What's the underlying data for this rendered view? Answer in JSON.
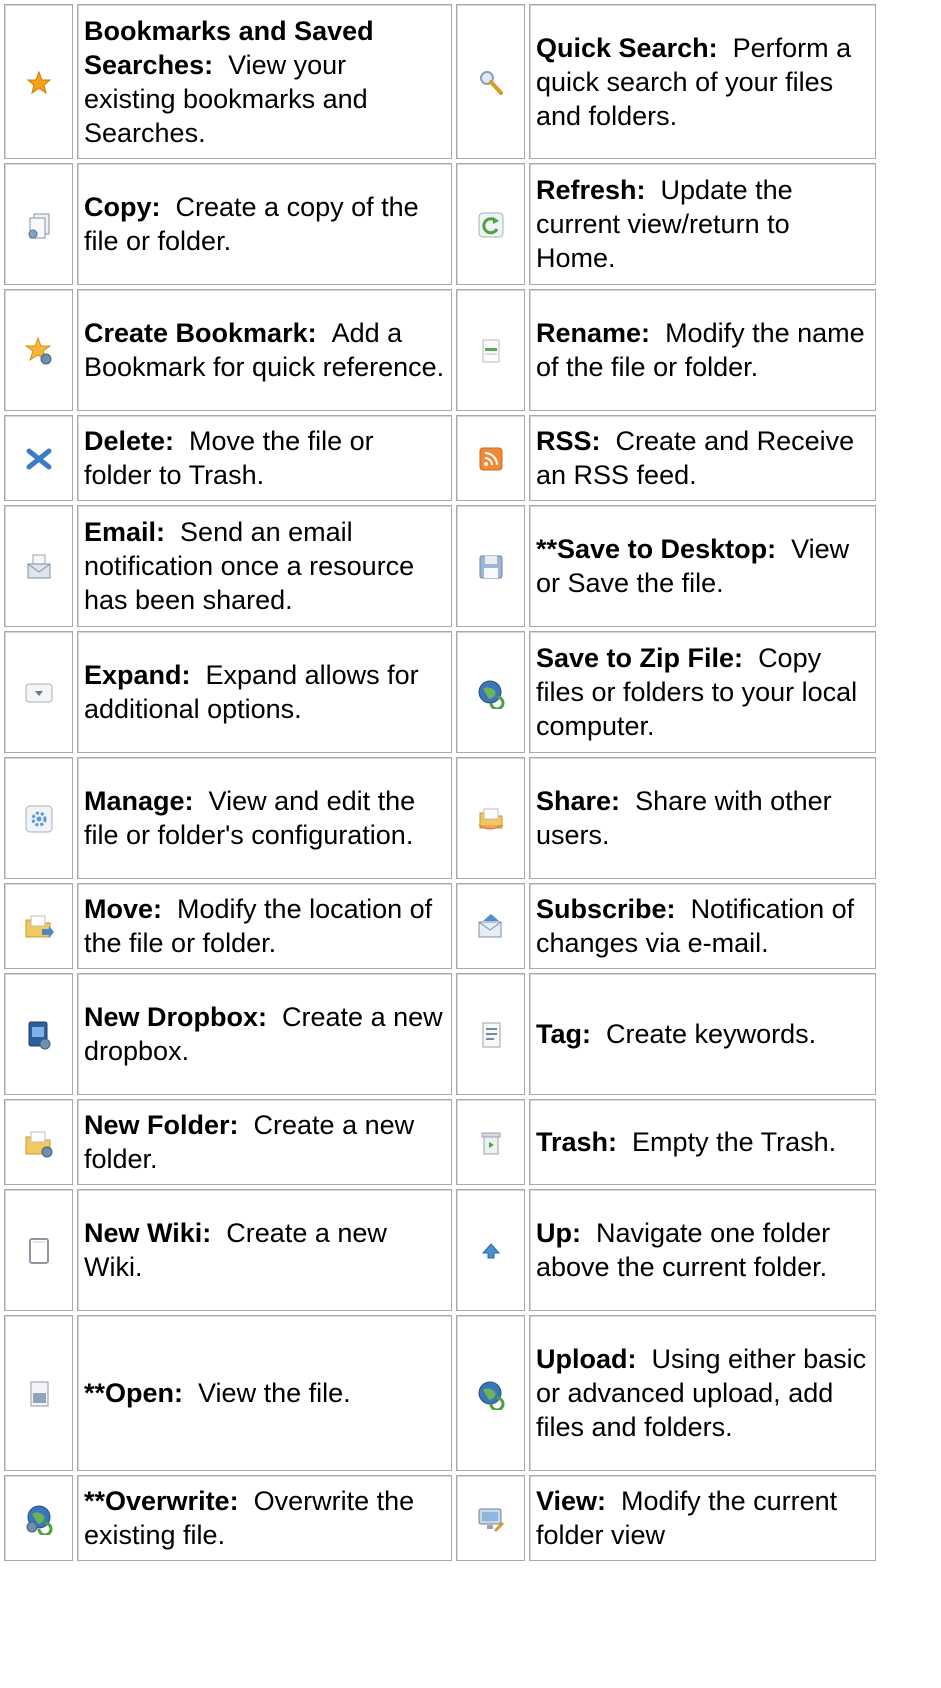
{
  "rows": [
    {
      "left": {
        "icon": "star-icon",
        "label": "Bookmarks and Saved Searches:",
        "text": "View your existing bookmarks and Searches."
      },
      "right": {
        "icon": "magnifier-icon",
        "label": "Quick Search:",
        "text": "Perform a quick search of your files and folders."
      }
    },
    {
      "left": {
        "icon": "copy-document-icon",
        "label": "Copy:",
        "text": "Create a copy of the file or folder."
      },
      "right": {
        "icon": "refresh-icon",
        "label": "Refresh:",
        "text": "Update the current view/return to Home."
      }
    },
    {
      "left": {
        "icon": "create-bookmark-icon",
        "label": "Create Bookmark:",
        "text": "Add a Bookmark for quick reference."
      },
      "right": {
        "icon": "rename-icon",
        "label": "Rename:",
        "text": "Modify the name of the file or folder."
      }
    },
    {
      "left": {
        "icon": "delete-x-icon",
        "label": "Delete:",
        "text": "Move the file or folder to Trash."
      },
      "right": {
        "icon": "rss-icon",
        "label": "RSS:",
        "text": "Create and Receive an RSS feed."
      }
    },
    {
      "left": {
        "icon": "email-icon",
        "label": "Email:",
        "text": "Send an email notification once a resource has been shared."
      },
      "right": {
        "icon": "floppy-disk-icon",
        "label": "**Save to Desktop:",
        "text": "View or Save the file."
      }
    },
    {
      "left": {
        "icon": "expand-dropdown-icon",
        "label": "Expand:",
        "text": "Expand allows for additional options."
      },
      "right": {
        "icon": "globe-zip-icon",
        "label": "Save to Zip File:",
        "text": "Copy files or folders to your local computer."
      }
    },
    {
      "left": {
        "icon": "manage-gear-icon",
        "label": "Manage:",
        "text": "View and edit the file or folder's configuration."
      },
      "right": {
        "icon": "share-folder-icon",
        "label": "Share:",
        "text": "Share with other users."
      }
    },
    {
      "left": {
        "icon": "move-folder-icon",
        "label": "Move:",
        "text": "Modify the location of the file or folder."
      },
      "right": {
        "icon": "subscribe-mail-icon",
        "label": "Subscribe:",
        "text": "Notification of changes via e-mail."
      }
    },
    {
      "left": {
        "icon": "new-dropbox-icon",
        "label": "New Dropbox:",
        "text": "Create a new dropbox."
      },
      "right": {
        "icon": "tag-document-icon",
        "label": "Tag:",
        "text": "Create keywords."
      }
    },
    {
      "left": {
        "icon": "new-folder-icon",
        "label": "New Folder:",
        "text": "Create a new folder."
      },
      "right": {
        "icon": "trash-can-icon",
        "label": "Trash:",
        "text": "Empty the Trash."
      }
    },
    {
      "left": {
        "icon": "notepad-icon",
        "label": "New Wiki:",
        "text": "Create a new Wiki."
      },
      "right": {
        "icon": "up-arrow-icon",
        "label": "Up:",
        "text": "Navigate one folder above the current folder."
      }
    },
    {
      "left": {
        "icon": "open-document-icon",
        "label": "**Open:",
        "text": "View the file."
      },
      "right": {
        "icon": "upload-globe-icon",
        "label": "Upload:",
        "text": "Using either basic or advanced upload, add files and folders."
      }
    },
    {
      "left": {
        "icon": "overwrite-globe-icon",
        "label": "**Overwrite:",
        "text": "Overwrite the existing file."
      },
      "right": {
        "icon": "view-monitor-icon",
        "label": "View:",
        "text": "Modify the current folder view"
      }
    }
  ]
}
